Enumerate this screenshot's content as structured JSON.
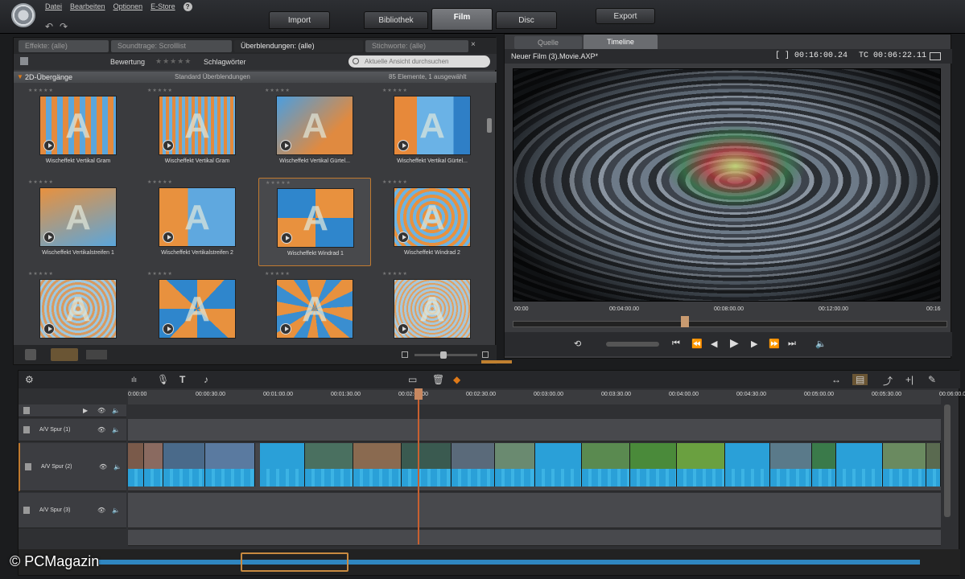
{
  "menu": {
    "items": [
      "Datei",
      "Bearbeiten",
      "Optionen",
      "E-Store"
    ]
  },
  "main_tabs": {
    "import": "Import",
    "library": "Bibliothek",
    "film": "Film",
    "disc": "Disc",
    "export": "Export"
  },
  "library": {
    "tabs": [
      "Effekte: (alle)",
      "Soundtrage: Scrolllist",
      "Überblendungen: (alle)",
      "Stichworte: (alle)"
    ],
    "close_label": "×",
    "rating_label": "Bewertung",
    "stars": "★★★★★",
    "tags_label": "Schlagwörter",
    "search_placeholder": "Aktuelle Ansicht durchsuchen",
    "group_title": "2D-Übergänge",
    "group_subtitle": "Standard Überblendungen",
    "group_count": "85 Elemente, 1 ausgewählt",
    "thumb_letter": "A",
    "items": [
      {
        "caption": "Wischeffekt Vertikal Gram",
        "pattern": "vstripes"
      },
      {
        "caption": "Wischeffekt Vertikal Gram",
        "pattern": "vstripes2"
      },
      {
        "caption": "Wischeffekt Vertikal Gürtel...",
        "pattern": "diag"
      },
      {
        "caption": "Wischeffekt Vertikal Gürtel...",
        "pattern": "orange-blue"
      },
      {
        "caption": "Wischeffekt Vertikalstreifen 1",
        "pattern": "grad"
      },
      {
        "caption": "Wischeffekt Vertikalstreifen 2",
        "pattern": "split"
      },
      {
        "caption": "Wischeffekt Windrad 1",
        "pattern": "swirl",
        "selected": true
      },
      {
        "caption": "Wischeffekt Windrad 2",
        "pattern": "spiral"
      },
      {
        "caption": "",
        "pattern": "rings"
      },
      {
        "caption": "",
        "pattern": "pinwheel"
      },
      {
        "caption": "",
        "pattern": "rays"
      },
      {
        "caption": "",
        "pattern": "rings2"
      }
    ]
  },
  "preview": {
    "tab_source": "Quelle",
    "tab_timeline": "Timeline",
    "movie_name": "Neuer Film (3).Movie.AXP*",
    "duration": "[ ] 00:16:00.24",
    "timecode": "TC 00:06:22.11",
    "ruler": [
      "00:00",
      "00:04:00.00",
      "00:08:00.00",
      "00:12:00.00",
      "00:16"
    ],
    "scrub_position": 0.4
  },
  "timeline": {
    "ruler": [
      "0:00:00",
      "00:00:30.00",
      "00:01:00.00",
      "00:01:30.00",
      "00:02:00.00",
      "00:02:30.00",
      "00:03:00.00",
      "00:03:30.00",
      "00:04:00.00",
      "00:04:30.00",
      "00:05:00.00",
      "00:05:30.00",
      "00:06:00.00"
    ],
    "tracks": [
      "A/V Spur (1)",
      "A/V Spur (2)",
      "A/V Spur (3)"
    ]
  },
  "watermark": "© PCMagazin",
  "colors": {
    "accent": "#e07a18",
    "audio": "#2aa0d8",
    "playhead": "#c86030"
  }
}
